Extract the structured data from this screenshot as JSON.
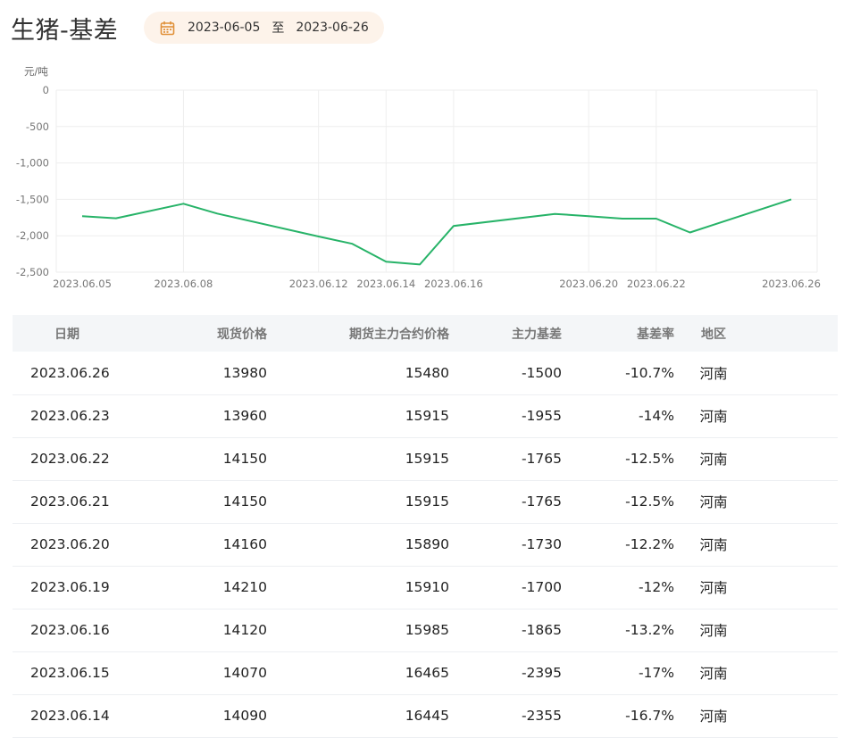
{
  "page": {
    "title": "生猪-基差"
  },
  "date_range": {
    "start": "2023-06-05",
    "separator": "至",
    "end": "2023-06-26",
    "icon": "calendar-icon"
  },
  "colors": {
    "line": "#27b368",
    "green_text": "#2f9d6a",
    "pill_bg": "#fdf3ea",
    "icon": "#e0913a"
  },
  "chart_data": {
    "type": "line",
    "unit_label": "元/吨",
    "ylim": [
      -2500,
      0
    ],
    "yticks": [
      "0",
      "-500",
      "-1,000",
      "-1,500",
      "-2,000",
      "-2,500"
    ],
    "ytick_values": [
      0,
      -500,
      -1000,
      -1500,
      -2000,
      -2500
    ],
    "xtick_labels": [
      "2023.06.05",
      "2023.06.08",
      "2023.06.12",
      "2023.06.14",
      "2023.06.16",
      "2023.06.20",
      "2023.06.22",
      "2023.06.26"
    ],
    "grid": true,
    "x": [
      "2023.06.05",
      "2023.06.06",
      "2023.06.08",
      "2023.06.09",
      "2023.06.12",
      "2023.06.13",
      "2023.06.14",
      "2023.06.15",
      "2023.06.16",
      "2023.06.19",
      "2023.06.20",
      "2023.06.21",
      "2023.06.22",
      "2023.06.23",
      "2023.06.26"
    ],
    "values": [
      -1730,
      -1760,
      -1560,
      -1695,
      -2010,
      -2110,
      -2355,
      -2395,
      -1865,
      -1700,
      -1730,
      -1765,
      -1765,
      -1955,
      -1500
    ]
  },
  "table": {
    "headers": {
      "date": "日期",
      "spot": "现货价格",
      "futures": "期货主力合约价格",
      "basis": "主力基差",
      "rate": "基差率",
      "region": "地区"
    },
    "rows": [
      {
        "date": "2023.06.26",
        "spot": "13980",
        "futures": "15480",
        "basis": "-1500",
        "rate": "-10.7%",
        "region": "河南"
      },
      {
        "date": "2023.06.23",
        "spot": "13960",
        "futures": "15915",
        "basis": "-1955",
        "rate": "-14%",
        "region": "河南"
      },
      {
        "date": "2023.06.22",
        "spot": "14150",
        "futures": "15915",
        "basis": "-1765",
        "rate": "-12.5%",
        "region": "河南"
      },
      {
        "date": "2023.06.21",
        "spot": "14150",
        "futures": "15915",
        "basis": "-1765",
        "rate": "-12.5%",
        "region": "河南"
      },
      {
        "date": "2023.06.20",
        "spot": "14160",
        "futures": "15890",
        "basis": "-1730",
        "rate": "-12.2%",
        "region": "河南"
      },
      {
        "date": "2023.06.19",
        "spot": "14210",
        "futures": "15910",
        "basis": "-1700",
        "rate": "-12%",
        "region": "河南"
      },
      {
        "date": "2023.06.16",
        "spot": "14120",
        "futures": "15985",
        "basis": "-1865",
        "rate": "-13.2%",
        "region": "河南"
      },
      {
        "date": "2023.06.15",
        "spot": "14070",
        "futures": "16465",
        "basis": "-2395",
        "rate": "-17%",
        "region": "河南"
      },
      {
        "date": "2023.06.14",
        "spot": "14090",
        "futures": "16445",
        "basis": "-2355",
        "rate": "-16.7%",
        "region": "河南"
      }
    ]
  }
}
